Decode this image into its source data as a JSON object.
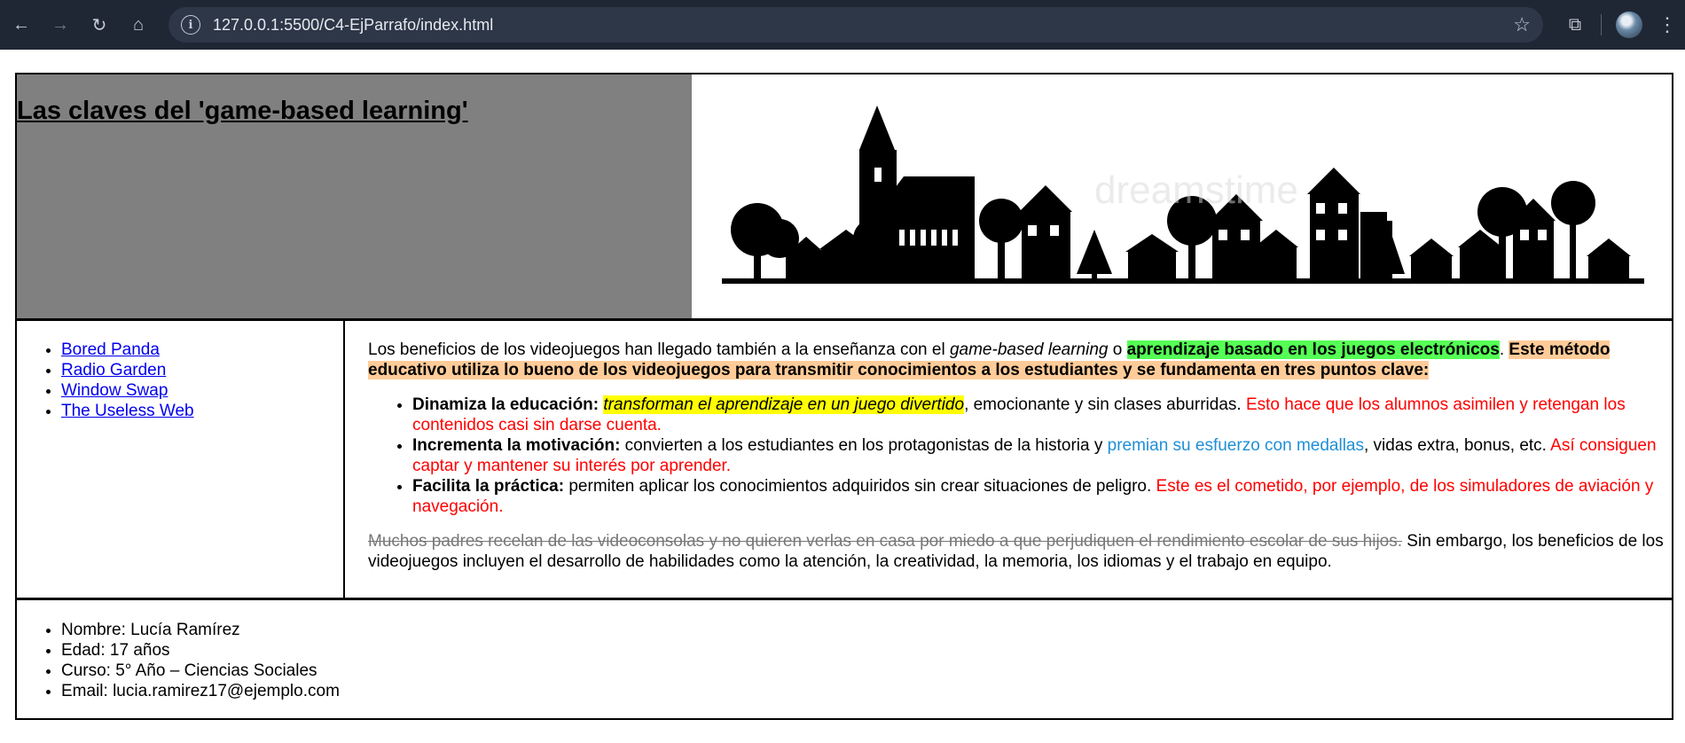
{
  "browser": {
    "url": "127.0.0.1:5500/C4-EjParrafo/index.html",
    "back_icon": "←",
    "forward_icon": "→",
    "reload_icon": "↻",
    "home_icon": "⌂",
    "info_icon": "i",
    "star_icon": "☆",
    "extensions_icon": "⧉",
    "menu_icon": "⋮"
  },
  "header": {
    "title": "Las claves del 'game-based learning'",
    "left_bg": "#808080"
  },
  "sidebar": {
    "links": [
      "Bored Panda",
      "Radio Garden",
      "Window Swap",
      "The Useless Web"
    ]
  },
  "content": {
    "intro": {
      "p1": "Los beneficios de los videojuegos han llegado también a la enseñanza con el ",
      "p1_italic": "game-based learning",
      "p1_o": " o ",
      "p1_green": "aprendizaje basado en los juegos electrónicos",
      "p1_dot": ". ",
      "p1_orange": "Este método educativo utiliza lo bueno de los videojuegos para transmitir conocimientos a los estudiantes y se fundamenta en tres puntos clave:"
    },
    "points": [
      {
        "bold": "Dinamiza la educación:",
        "yellow": "transforman el aprendizaje en un juego divertido",
        "text": ", emocionante y sin clases aburridas. ",
        "red": "Esto hace que los alumnos asimilen y retengan los contenidos casi sin darse cuenta."
      },
      {
        "bold": "Incrementa la motivación:",
        "text": " convierten a los estudiantes en los protagonistas de la historia y ",
        "blue": "premian su esfuerzo con medallas",
        "text2": ", vidas extra, bonus, etc. ",
        "red": "Así consiguen captar y mantener su interés por aprender."
      },
      {
        "bold": "Facilita la práctica:",
        "text": " permiten aplicar los conocimientos adquiridos sin crear situaciones de peligro. ",
        "red": "Este es el cometido, por ejemplo, de los simuladores de aviación y navegación."
      }
    ],
    "closing": {
      "strike": "Muchos padres recelan de las videoconsolas y no quieren verlas en casa por miedo a que perjudiquen el rendimiento escolar de sus hijos.",
      "text": " Sin embargo, los beneficios de los videojuegos incluyen el desarrollo de habilidades como la atención, la creatividad, la memoria, los idiomas y el trabajo en equipo."
    }
  },
  "footer": {
    "items": [
      "Nombre: Lucía Ramírez",
      "Edad: 17 años",
      "Curso: 5° Año – Ciencias Sociales",
      "Email: lucia.ramirez17@ejemplo.com"
    ]
  },
  "skyline": {
    "watermark": "dreamstime"
  }
}
